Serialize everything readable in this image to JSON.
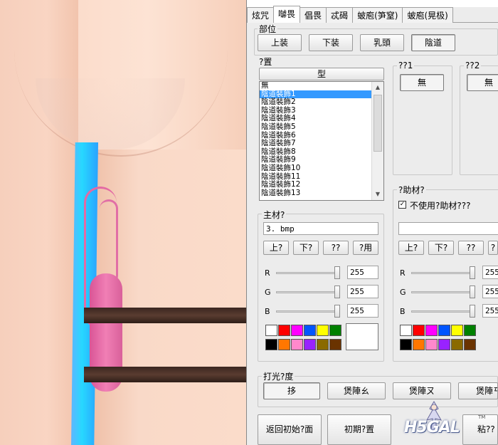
{
  "tabs": [
    "炫咒",
    "嚹畏",
    "倡畏",
    "忒碣",
    "蚾庖(笋窒)",
    "蚾庖(晃极)"
  ],
  "part": {
    "label": "部位",
    "buttons": [
      "上装",
      "下装",
      "乳頭",
      "陰道"
    ]
  },
  "placement": {
    "label": "?置",
    "list_header": "型",
    "items": [
      "無",
      "陰道裝飾1",
      "陰道裝飾2",
      "陰道裝飾3",
      "陰道裝飾4",
      "陰道裝飾5",
      "陰道裝飾6",
      "陰道裝飾7",
      "陰道裝飾8",
      "陰道裝飾9",
      "陰道裝飾10",
      "陰道裝飾11",
      "陰道裝飾12",
      "陰道裝飾13"
    ],
    "selected_index": 1
  },
  "slot1": {
    "label": "??1",
    "button": "無"
  },
  "slot2": {
    "label": "??2",
    "button": "無"
  },
  "main_material": {
    "label": "主材?",
    "value": "3. bmp",
    "buttons": [
      "上?",
      "下?",
      "??",
      "?用"
    ],
    "rgb": [
      {
        "label": "R",
        "value": "255",
        "level": 1.0
      },
      {
        "label": "G",
        "value": "255",
        "level": 1.0
      },
      {
        "label": "B",
        "value": "255",
        "level": 1.0
      }
    ]
  },
  "aux_material": {
    "label": "?助材?",
    "checkbox_label": "不使用?助材???",
    "checked": true,
    "value": "",
    "buttons": [
      "上?",
      "下?",
      "??",
      "?"
    ],
    "rgb": [
      {
        "label": "R",
        "value": "255",
        "level": 1.0
      },
      {
        "label": "G",
        "value": "255",
        "level": 1.0
      },
      {
        "label": "B",
        "value": "255",
        "level": 1.0
      }
    ]
  },
  "palette": [
    "#ffffff",
    "#ff0000",
    "#ff00ff",
    "#0055ff",
    "#ffff00",
    "#008000",
    "#000000",
    "#ff7700",
    "#ff88cc",
    "#9922ff",
    "#8a6a00",
    "#6a3300"
  ],
  "lighting": {
    "label": "打光?度",
    "buttons": [
      "拸",
      "煲陣ㄠ",
      "煲陣ㄡ",
      "煲陣ㄢ"
    ]
  },
  "bottom": {
    "reset": "返回初始?面",
    "init": "初期?置",
    "paste": "粘??"
  },
  "logo": {
    "text": "H5GAL",
    "tm": "TM"
  }
}
